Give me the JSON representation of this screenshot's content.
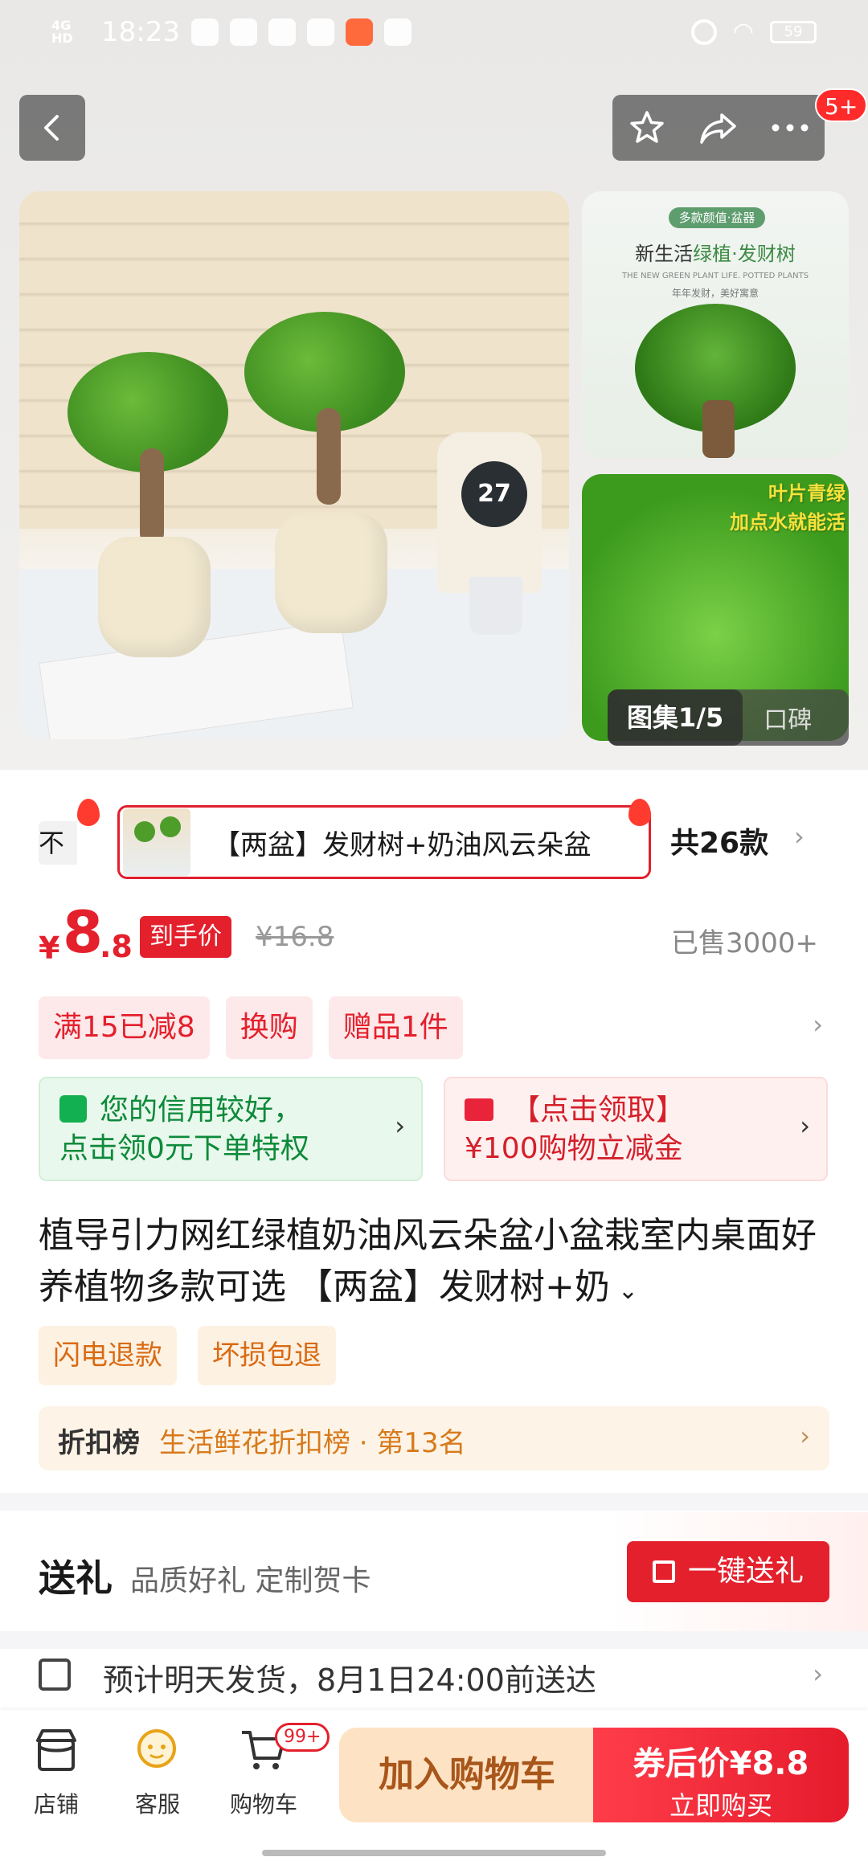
{
  "status_bar": {
    "time": "18:23",
    "network": "4G HD",
    "battery": "59"
  },
  "header": {
    "notification_badge": "5+",
    "icons": [
      "back-icon",
      "star-icon",
      "share-icon",
      "more-icon"
    ]
  },
  "gallery": {
    "thumb1_tag": "多款颜值·盆器",
    "thumb1_title_a": "新生活",
    "thumb1_title_b": "绿植·发财树",
    "thumb1_subtitle": "THE NEW GREEN PLANT LIFE. POTTED PLANTS",
    "thumb1_slogan": "年年发财，美好寓意",
    "thumb2_line1": "叶片青绿",
    "thumb2_line2": "加点水就能活",
    "clock_number": "27",
    "active_tab": "图集1/5",
    "other_tab": "口碑"
  },
  "variants": {
    "prev_label": "不",
    "selected_label": "【两盆】发财树+奶油风云朵盆",
    "count_label": "共26款"
  },
  "price": {
    "symbol": "¥",
    "integer": "8",
    "decimal": ".8",
    "tag": "到手价",
    "original": "¥16.8",
    "sold": "已售3000+"
  },
  "promotions": [
    "满15已减8",
    "换购",
    "赠品1件"
  ],
  "cards": {
    "green_line1": "您的信用较好，",
    "green_line2": "点击领0元下单特权",
    "red_line1": "【点击领取】",
    "red_line2": "¥100购物立减金"
  },
  "product_title": "植导引力网红绿植奶油风云朵盆小盆栽室内桌面好养植物多款可选 【两盆】发财树+奶",
  "services": [
    "闪电退款",
    "坏损包退"
  ],
  "ranking": {
    "label": "折扣榜",
    "text": "生活鲜花折扣榜 · 第13名"
  },
  "gift": {
    "title": "送礼",
    "subtitle": "品质好礼 定制贺卡",
    "button": "一键送礼"
  },
  "shipping": {
    "text": "预计明天发货，8月1日24:00前送达"
  },
  "bottom_nav": {
    "store": "店铺",
    "service": "客服",
    "cart": "购物车",
    "cart_badge": "99+",
    "add_to_cart": "加入购物车",
    "buy_line1": "券后价¥8.8",
    "buy_line2": "立即购买"
  },
  "colors": {
    "accent_red": "#e4202c",
    "green": "#0d8a3a",
    "orange": "#d96a12"
  }
}
